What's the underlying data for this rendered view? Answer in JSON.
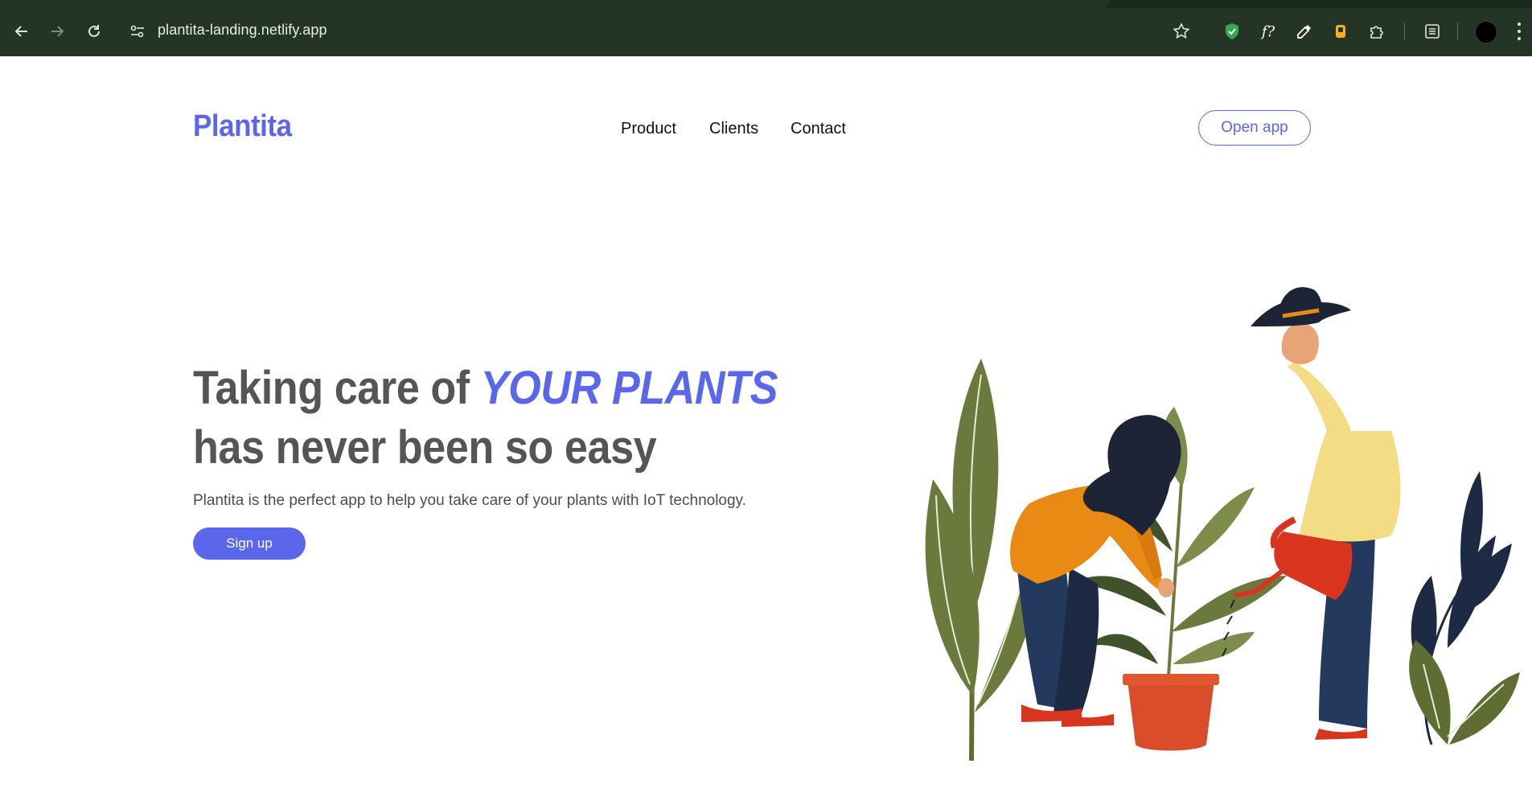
{
  "browser": {
    "url": "plantita-landing.netlify.app",
    "icons": [
      "back-arrow-icon",
      "forward-arrow-icon",
      "reload-icon",
      "site-info-icon",
      "bookmark-star-icon",
      "shield-extension-icon",
      "font-extension-icon",
      "eyedropper-extension-icon",
      "yellow-extension-icon",
      "puzzle-extensions-icon",
      "reading-list-icon",
      "profile-avatar",
      "more-menu-icon"
    ]
  },
  "header": {
    "logo": "Plantita",
    "nav": [
      "Product",
      "Clients",
      "Contact"
    ],
    "cta": "Open app"
  },
  "hero": {
    "title_prefix": "Taking care of ",
    "title_accent": "YOUR PLANTS",
    "title_suffix": " has never been so easy",
    "subtitle": "Plantita is the perfect app to help you take care of your plants with IoT technology.",
    "button": "Sign up"
  },
  "colors": {
    "brand": "#5b67ea",
    "heading": "#555555",
    "chrome": "#243425"
  }
}
